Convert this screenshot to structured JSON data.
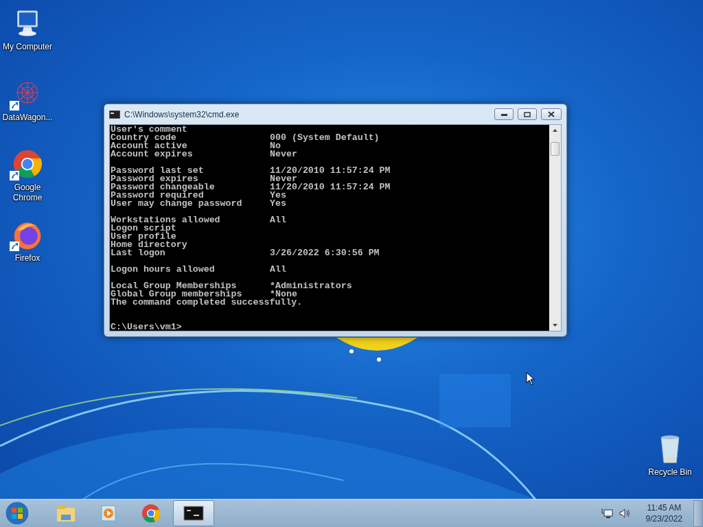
{
  "desktop_icons": [
    {
      "label": "My Computer",
      "kind": "computer",
      "shortcut": false
    },
    {
      "label": "DataWagon...",
      "kind": "app",
      "shortcut": true
    },
    {
      "label": "Google Chrome",
      "kind": "chrome",
      "shortcut": true
    },
    {
      "label": "Firefox",
      "kind": "firefox",
      "shortcut": true
    },
    {
      "label": "Recycle Bin",
      "kind": "recycle",
      "shortcut": false
    }
  ],
  "window": {
    "title": "C:\\Windows\\system32\\cmd.exe",
    "console": {
      "lines": [
        {
          "kind": "field",
          "label": "User's comment"
        },
        {
          "kind": "field",
          "label": "Country code",
          "value": "000 (System Default)"
        },
        {
          "kind": "field",
          "label": "Account active",
          "value": "No"
        },
        {
          "kind": "field",
          "label": "Account expires",
          "value": "Never"
        },
        {
          "kind": "blank"
        },
        {
          "kind": "field",
          "label": "Password last set",
          "value": "11/20/2010 11:57:24 PM"
        },
        {
          "kind": "field",
          "label": "Password expires",
          "value": "Never"
        },
        {
          "kind": "field",
          "label": "Password changeable",
          "value": "11/20/2010 11:57:24 PM"
        },
        {
          "kind": "field",
          "label": "Password required",
          "value": "Yes"
        },
        {
          "kind": "field",
          "label": "User may change password",
          "value": "Yes"
        },
        {
          "kind": "blank"
        },
        {
          "kind": "field",
          "label": "Workstations allowed",
          "value": "All"
        },
        {
          "kind": "field",
          "label": "Logon script"
        },
        {
          "kind": "field",
          "label": "User profile"
        },
        {
          "kind": "field",
          "label": "Home directory"
        },
        {
          "kind": "field",
          "label": "Last logon",
          "value": "3/26/2022 6:30:56 PM"
        },
        {
          "kind": "blank"
        },
        {
          "kind": "field",
          "label": "Logon hours allowed",
          "value": "All"
        },
        {
          "kind": "blank"
        },
        {
          "kind": "field",
          "label": "Local Group Memberships",
          "value": "*Administrators"
        },
        {
          "kind": "field",
          "label": "Global Group memberships",
          "value": "*None"
        },
        {
          "kind": "text",
          "label": "The command completed successfully."
        },
        {
          "kind": "blank"
        },
        {
          "kind": "blank"
        },
        {
          "kind": "text",
          "label": "C:\\Users\\vm1>"
        }
      ]
    }
  },
  "taskbar": {
    "items": [
      {
        "kind": "explorer",
        "selected": false
      },
      {
        "kind": "media",
        "selected": false
      },
      {
        "kind": "chrome",
        "selected": false
      },
      {
        "kind": "console",
        "selected": true
      }
    ],
    "clock": {
      "time": "11:45 AM",
      "date": "9/23/2022"
    }
  }
}
